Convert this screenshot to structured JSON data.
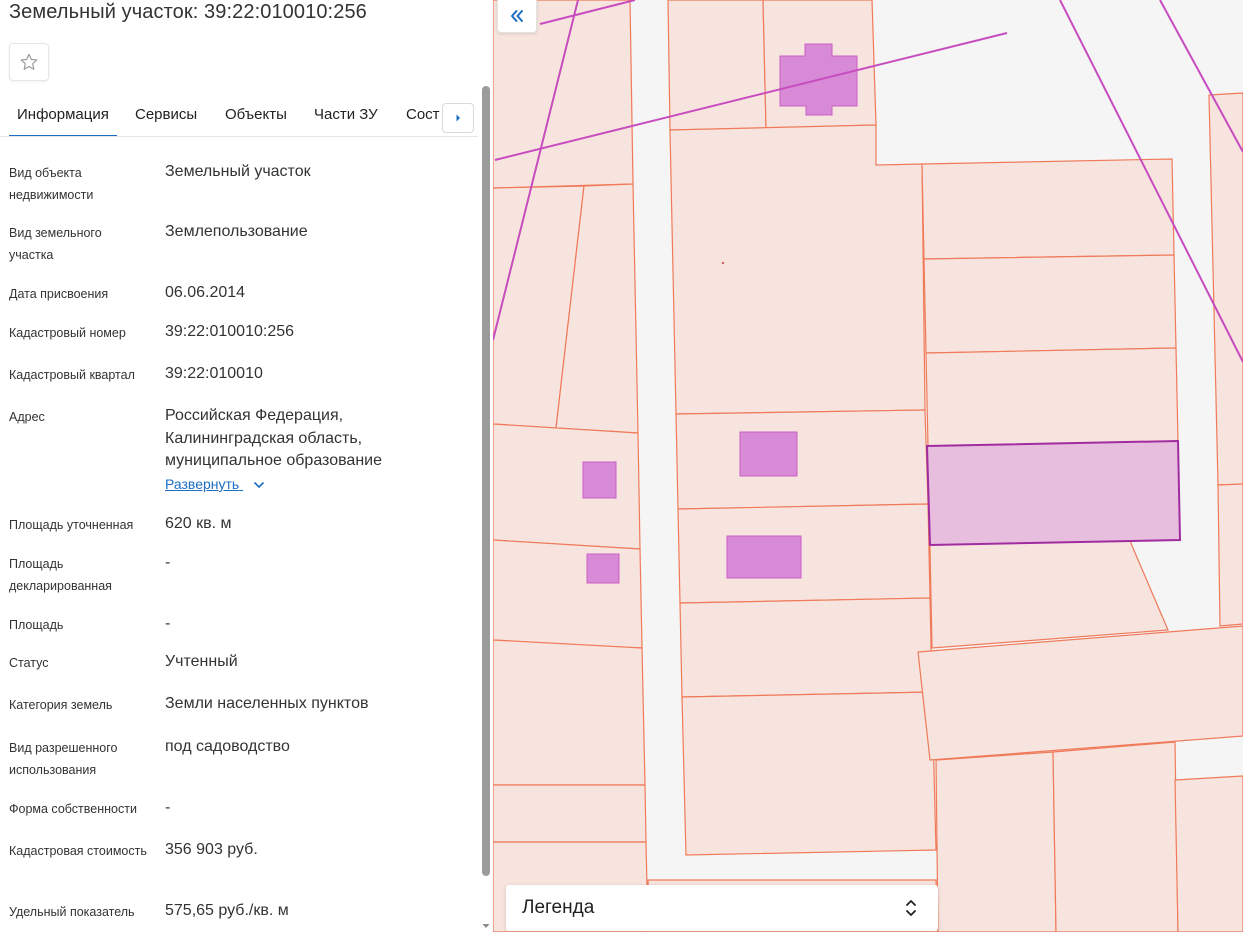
{
  "panel": {
    "title": "Земельный участок: 39:22:010010:256",
    "favorite_icon": "star-outline-icon",
    "tabs": [
      {
        "label": "Информация",
        "active": true
      },
      {
        "label": "Сервисы",
        "active": false
      },
      {
        "label": "Объекты",
        "active": false
      },
      {
        "label": "Части ЗУ",
        "active": false
      },
      {
        "label": "Состав",
        "active": false
      }
    ],
    "tabs_next_icon": "chevron-right-icon",
    "properties": [
      {
        "label": "Вид объекта недвижимости",
        "value": "Земельный участок"
      },
      {
        "label": "Вид земельного участка",
        "value": "Землепользование"
      },
      {
        "label": "Дата присвоения",
        "value": "06.06.2014"
      },
      {
        "label": "Кадастровый номер",
        "value": "39:22:010010:256"
      },
      {
        "label": "Кадастровый квартал",
        "value": "39:22:010010"
      },
      {
        "label": "Адрес",
        "value": "Российская Федерация, Калининградская область, муниципальное образование",
        "link": "Развернуть"
      },
      {
        "label": "Площадь уточненная",
        "value": "620 кв. м"
      },
      {
        "label": "Площадь декларированная",
        "value": "-"
      },
      {
        "label": "Площадь",
        "value": "-"
      },
      {
        "label": "Статус",
        "value": "Учтенный"
      },
      {
        "label": "Категория земель",
        "value": "Земли населенных пунктов"
      },
      {
        "label": "Вид разрешенного использования",
        "value": "под садоводство"
      },
      {
        "label": "Форма собственности",
        "value": "-"
      },
      {
        "label": "Кадастровая стоимость",
        "value": "356 903 руб."
      },
      {
        "label": "Удельный показатель",
        "value": "575,65 руб./кв. м"
      }
    ]
  },
  "map": {
    "collapse_icon": "double-chevron-left-icon",
    "legend_label": "Легенда",
    "legend_toggle_icon": "chevron-updown-icon",
    "colors": {
      "background": "#f5f5f5",
      "parcel_fill": "#f8e4de",
      "parcel_stroke": "#ef7a5a",
      "building_fill": "#d98ad6",
      "building_stroke": "#c85fc5",
      "selected_fill": "#e8bedf",
      "selected_stroke": "#a02ca0",
      "boundary_line": "#c64cbf"
    }
  }
}
